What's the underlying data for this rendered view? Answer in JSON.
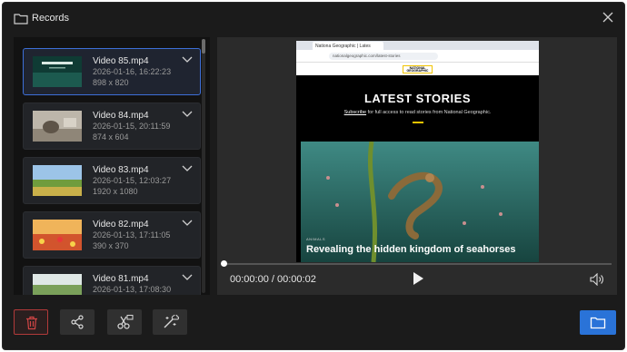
{
  "window": {
    "title": "Records"
  },
  "records": [
    {
      "name": "Video 85.mp4",
      "date": "2026-01-16, 16:22:23",
      "resolution": "898 x 820",
      "selected": true
    },
    {
      "name": "Video 84.mp4",
      "date": "2026-01-15, 20:11:59",
      "resolution": "874 x 604",
      "selected": false
    },
    {
      "name": "Video 83.mp4",
      "date": "2026-01-15, 12:03:27",
      "resolution": "1920 x 1080",
      "selected": false
    },
    {
      "name": "Video 82.mp4",
      "date": "2026-01-13, 17:11:05",
      "resolution": "390 x 370",
      "selected": false
    },
    {
      "name": "Video 81.mp4",
      "date": "2026-01-13, 17:08:30",
      "resolution": "",
      "selected": false
    }
  ],
  "player": {
    "time": "00:00:00 / 00:00:02",
    "progress": 0
  },
  "video_content": {
    "tab_title": "Nationa Geographic | Lates",
    "url": "nationalgeographic.com/latest-stories",
    "logo": "NATIONAL GEOGRAPHIC",
    "heading": "LATEST STORIES",
    "subscribe_link": "Subscribe",
    "subscribe_rest": " for full access to read stories from National Geographic.",
    "story_tag": "ANIMALS",
    "story_title": "Revealing the hidden kingdom of seahorses"
  },
  "toolbar": {
    "icons": [
      "trash-icon",
      "share-icon",
      "scissors-icon",
      "magic-wand-icon",
      "folder-icon"
    ]
  },
  "colors": {
    "accent": "#2a73d8",
    "delete": "#b23a3a",
    "background": "#1b1b1b"
  }
}
